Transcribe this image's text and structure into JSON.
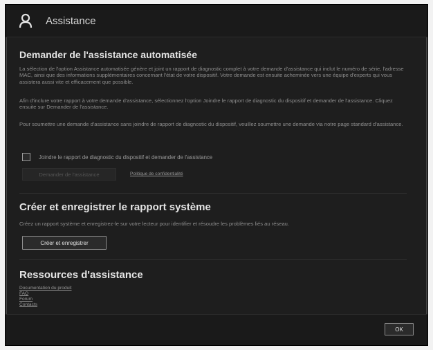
{
  "header": {
    "title": "Assistance",
    "icon": "person-icon"
  },
  "section1": {
    "title": "Demander de l'assistance automatisée",
    "para1": "La sélection de l'option Assistance automatisée génère et joint un rapport de diagnostic complet à votre demande d'assistance qui inclut le numéro de série, l'adresse MAC, ainsi que des informations supplémentaires concernant l'état de votre dispositif. Votre demande est ensuite acheminée vers une équipe d'experts qui vous assistera aussi vite et efficacement que possible.",
    "para2": "Afin d'inclure votre rapport à votre demande d'assistance, sélectionnez l'option Joindre le rapport de diagnostic du dispositif et demander de l'assistance. Cliquez ensuite sur Demander de l'assistance.",
    "para3": "Pour soumettre une demande d'assistance sans joindre de rapport de diagnostic du dispositif, veuillez soumettre une demande via notre page standard d'assistance.",
    "checkbox_label": "Joindre le rapport de diagnostic du dispositif et demander de l'assistance",
    "request_button": "Demander de l'assistance",
    "privacy_link": "Politique de confidentialité"
  },
  "section2": {
    "title": "Créer et enregistrer le rapport système",
    "para": "Créez un rapport système et enregistrez-le sur votre lecteur pour identifier et résoudre les problèmes liés au réseau.",
    "button": "Créer et enregistrer"
  },
  "section3": {
    "title": "Ressources d'assistance",
    "links": [
      "Documentation du produit",
      "FAQ",
      "Forum",
      "Contacts"
    ]
  },
  "footer": {
    "ok_button": "OK"
  }
}
